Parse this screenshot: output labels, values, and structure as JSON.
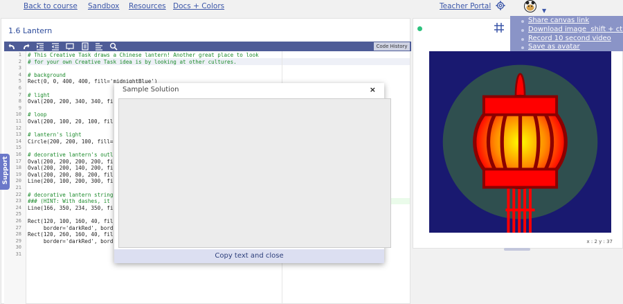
{
  "nav": {
    "back_to_course": "Back to course",
    "sandbox": "Sandbox",
    "resources": "Resources",
    "docs_colors": "Docs + Colors",
    "teacher_portal": "Teacher Portal"
  },
  "dropdown": {
    "items": [
      "Share canvas link",
      "Download image",
      "Record 10 second video",
      "Save as avatar"
    ],
    "download_shortcut": "shift + ctrl + s"
  },
  "editor": {
    "task_title": "1.6 Lantern",
    "code_history": "Code History",
    "line_numbers": [
      "1",
      "2",
      "3",
      "4",
      "5",
      "6",
      "7",
      "8",
      "9",
      "10",
      "11",
      "12",
      "13",
      "14",
      "15",
      "16",
      "17",
      "18",
      "19",
      "20",
      "21",
      "22",
      "23",
      "24",
      "25",
      "26",
      "27",
      "28",
      "29",
      "30",
      "31"
    ],
    "lines": [
      "# This Creative Task draws a Chinese lantern! Another great place to look",
      "# for your own Creative Task idea is by looking at other cultures.",
      "",
      "# background",
      "Rect(0, 0, 400, 400, fill='midnightBlue')",
      "",
      "# light",
      "Oval(200, 200, 340, 340, fi",
      "",
      "# loop",
      "Oval(200, 100, 20, 100, fil",
      "",
      "# lantern's light",
      "Circle(200, 200, 100, fill=",
      "",
      "# decorative lantern's outl",
      "Oval(200, 200, 200, 200, fi",
      "Oval(200, 200, 140, 200, fi",
      "Oval(200, 200, 80, 200, fil",
      "Line(200, 100, 200, 300, fi",
      "",
      "# decorative lantern string",
      "### (HINT: With dashes, it ",
      "Line(166, 350, 234, 350, fi",
      "",
      "Rect(120, 100, 160, 40, fil",
      "     border='darkRed', bord",
      "Rect(120, 260, 160, 40, fil",
      "     border='darkRed', bord",
      "",
      ""
    ]
  },
  "canvas": {
    "coords": "x : 2 y : 37"
  },
  "support": {
    "label": "Support"
  },
  "modal": {
    "title": "Sample Solution",
    "close": "×",
    "footer": "Copy text and close"
  },
  "colors": {
    "toolbar": "#4e5c97",
    "dropdown": "#8a94c7",
    "support": "#6b78c9",
    "background": "#191970",
    "lantern_red": "#ff0000"
  }
}
